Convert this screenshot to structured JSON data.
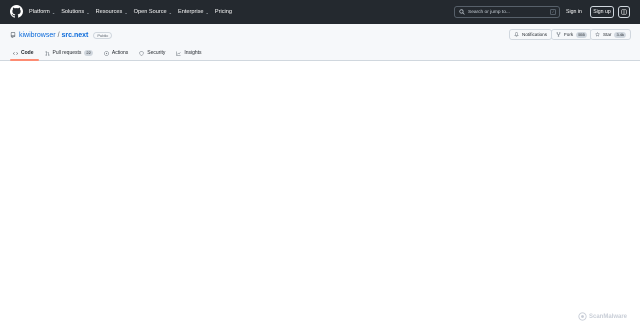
{
  "header": {
    "nav": [
      {
        "label": "Platform",
        "has_chevron": true
      },
      {
        "label": "Solutions",
        "has_chevron": true
      },
      {
        "label": "Resources",
        "has_chevron": true
      },
      {
        "label": "Open Source",
        "has_chevron": true
      },
      {
        "label": "Enterprise",
        "has_chevron": true
      },
      {
        "label": "Pricing",
        "has_chevron": false
      }
    ],
    "search_placeholder": "Search or jump to...",
    "search_shortcut": "/",
    "signin_label": "Sign in",
    "signup_label": "Sign up"
  },
  "repo": {
    "owner": "kiwibrowser",
    "separator": "/",
    "name": "src.next",
    "visibility": "Public",
    "notifications_label": "Notifications",
    "fork_label": "Fork",
    "fork_count": "555",
    "star_label": "Star",
    "star_count": "3.4k"
  },
  "tabs": [
    {
      "label": "Code",
      "icon": "code-icon",
      "active": true
    },
    {
      "label": "Pull requests",
      "icon": "pull-request-icon",
      "count": "22"
    },
    {
      "label": "Actions",
      "icon": "play-icon"
    },
    {
      "label": "Security",
      "icon": "shield-icon"
    },
    {
      "label": "Insights",
      "icon": "graph-icon"
    }
  ],
  "watermark": "ScanMalware",
  "colors": {
    "header_bg": "#24292f",
    "repohead_bg": "#f6f8fa",
    "link": "#0969da",
    "active_tab_underline": "#fd8c73"
  }
}
